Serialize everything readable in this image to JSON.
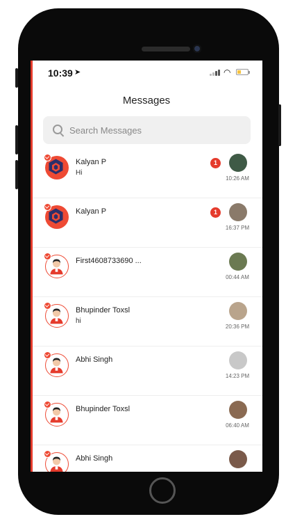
{
  "status_bar": {
    "time": "10:39",
    "location_icon": "location-arrow-icon"
  },
  "header": {
    "title": "Messages"
  },
  "search": {
    "placeholder": "Search Messages"
  },
  "colors": {
    "accent": "#e53b2c"
  },
  "conversations": [
    {
      "name": "Kalyan P",
      "message": "Hi",
      "unread": "1",
      "time": "10:26 AM",
      "avatar": "brand-logo",
      "thumb_color": "#3f5a46"
    },
    {
      "name": "Kalyan P",
      "message": "",
      "unread": "1",
      "time": "16:37 PM",
      "avatar": "brand-logo",
      "thumb_color": "#8a7a6a"
    },
    {
      "name": "First4608733690 ...",
      "message": "",
      "unread": "",
      "time": "00:44 AM",
      "avatar": "person",
      "thumb_color": "#6b7a52"
    },
    {
      "name": "Bhupinder Toxsl",
      "message": "hi",
      "unread": "",
      "time": "20:36 PM",
      "avatar": "person",
      "thumb_color": "#b9a48c"
    },
    {
      "name": "Abhi Singh",
      "message": "",
      "unread": "",
      "time": "14:23 PM",
      "avatar": "person",
      "thumb_color": "#c8c8c8"
    },
    {
      "name": "Bhupinder Toxsl",
      "message": "",
      "unread": "",
      "time": "06:40 AM",
      "avatar": "person",
      "thumb_color": "#8a6a52"
    },
    {
      "name": "Abhi Singh",
      "message": "",
      "unread": "",
      "time": "",
      "avatar": "person",
      "thumb_color": "#7a5a4a"
    }
  ]
}
